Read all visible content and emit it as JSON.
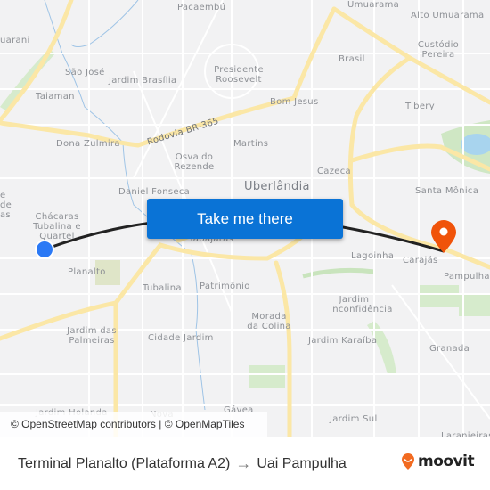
{
  "map": {
    "city_label": "Uberlândia",
    "road_label": "Rodovia BR-365",
    "neighborhoods": [
      {
        "name": "Pacaembú"
      },
      {
        "name": "Umuarama"
      },
      {
        "name": "Alto Umuarama"
      },
      {
        "name": "uarani"
      },
      {
        "name": "Custódio Pereira"
      },
      {
        "name": "São José"
      },
      {
        "name": "Jardim Brasília"
      },
      {
        "name": "Presidente Roosevelt"
      },
      {
        "name": "Brasil"
      },
      {
        "name": "Taiaman"
      },
      {
        "name": "Bom Jesus"
      },
      {
        "name": "Tibery"
      },
      {
        "name": "Dona Zulmira"
      },
      {
        "name": "Martins"
      },
      {
        "name": "Osvaldo Rezende"
      },
      {
        "name": "Cazeca"
      },
      {
        "name": "Daniel Fonseca"
      },
      {
        "name": "Santa Mônica"
      },
      {
        "name": "e de as"
      },
      {
        "name": "Chácaras Tubalina e Quartel"
      },
      {
        "name": "Tabajaras"
      },
      {
        "name": "Lagoinha"
      },
      {
        "name": "Carajás"
      },
      {
        "name": "Planalto"
      },
      {
        "name": "Pampulha"
      },
      {
        "name": "Tubalina"
      },
      {
        "name": "Patrimônio"
      },
      {
        "name": "Jardim Inconfidência"
      },
      {
        "name": "Morada da Colina"
      },
      {
        "name": "Jardim das Palmeiras"
      },
      {
        "name": "Cidade Jardim"
      },
      {
        "name": "Jardim Karaíba"
      },
      {
        "name": "Granada"
      },
      {
        "name": "Jardim Holanda"
      },
      {
        "name": "Nova"
      },
      {
        "name": "Gávea"
      },
      {
        "name": "Jardim Sul"
      },
      {
        "name": "Laranjeiras"
      }
    ],
    "origin_marker": {
      "icon": "origin-dot-icon",
      "color": "#2b79f5"
    },
    "destination_marker": {
      "icon": "destination-pin-icon",
      "color": "#f0530a"
    },
    "route_color": "#222222"
  },
  "cta": {
    "label": "Take me there",
    "color": "#0a73d6"
  },
  "attribution": "© OpenStreetMap contributors | © OpenMapTiles",
  "footer": {
    "origin": "Terminal Planalto (Plataforma A2)",
    "arrow": "→",
    "destination": "Uai Pampulha",
    "brand": "moovit",
    "brand_color": "#f26b21"
  }
}
